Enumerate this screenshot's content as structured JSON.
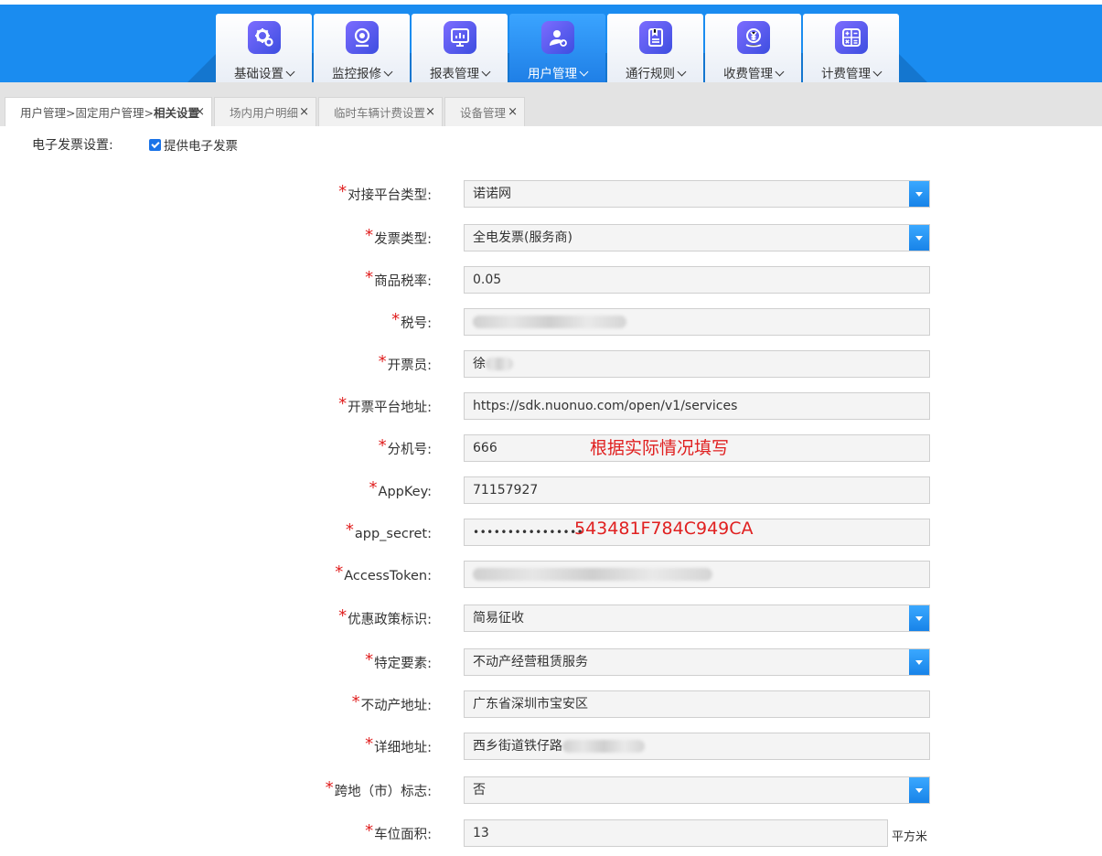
{
  "nav": {
    "tabs": [
      {
        "label": "基础设置",
        "icon": "gear-icon"
      },
      {
        "label": "监控报修",
        "icon": "camera-icon"
      },
      {
        "label": "报表管理",
        "icon": "report-chart-icon"
      },
      {
        "label": "用户管理",
        "icon": "user-settings-icon",
        "active": true
      },
      {
        "label": "通行规则",
        "icon": "rule-book-icon"
      },
      {
        "label": "收费管理",
        "icon": "yuan-coin-icon"
      },
      {
        "label": "计费管理",
        "icon": "calculator-icon"
      }
    ],
    "active_color": "#1f7fe6"
  },
  "page_tabs": [
    {
      "label_prefix": "用户管理>固定用户管理>",
      "label_bold": "相关设置",
      "close": "×",
      "active": true
    },
    {
      "label": "场内用户明细",
      "close": "×"
    },
    {
      "label": "临时车辆计费设置",
      "close": "×"
    },
    {
      "label": "设备管理",
      "close": "×"
    }
  ],
  "invoice": {
    "label": "电子发票设置:",
    "checkbox_label": "提供电子发票",
    "checked": true
  },
  "form": {
    "platform_type": {
      "label": "对接平台类型:",
      "value": "诺诺网"
    },
    "invoice_type": {
      "label": "发票类型:",
      "value": "全电发票(服务商)"
    },
    "tax_rate": {
      "label": "商品税率:",
      "value": "0.05"
    },
    "tax_no": {
      "label": "税号:"
    },
    "issuer": {
      "label": "开票员:",
      "value": "徐"
    },
    "platform_url": {
      "label": "开票平台地址:",
      "value": "https://sdk.nuonuo.com/open/v1/services"
    },
    "extension": {
      "label": "分机号:",
      "value": "666",
      "note": "根据实际情况填写"
    },
    "app_key": {
      "label": "AppKey:",
      "value": "71157927"
    },
    "app_secret": {
      "label": "app_secret:",
      "value": "••••••••••••••••",
      "note": "543481F784C949CA"
    },
    "access_token": {
      "label": "AccessToken:"
    },
    "policy_flag": {
      "label": "优惠政策标识:",
      "value": "简易征收"
    },
    "specific_element": {
      "label": "特定要素:",
      "value": "不动产经营租赁服务"
    },
    "property_address": {
      "label": "不动产地址:",
      "value": "广东省深圳市宝安区"
    },
    "detail_address": {
      "label": "详细地址:",
      "value": "西乡街道铁仔路"
    },
    "cross_region": {
      "label": "跨地（市）标志:",
      "value": "否"
    },
    "parking_area": {
      "label": "车位面积:",
      "value": "13",
      "unit": "平方米"
    }
  },
  "required_mark": "*",
  "colors": {
    "required": "#e02020",
    "note": "#e02020",
    "select_button": "#1883e8"
  }
}
